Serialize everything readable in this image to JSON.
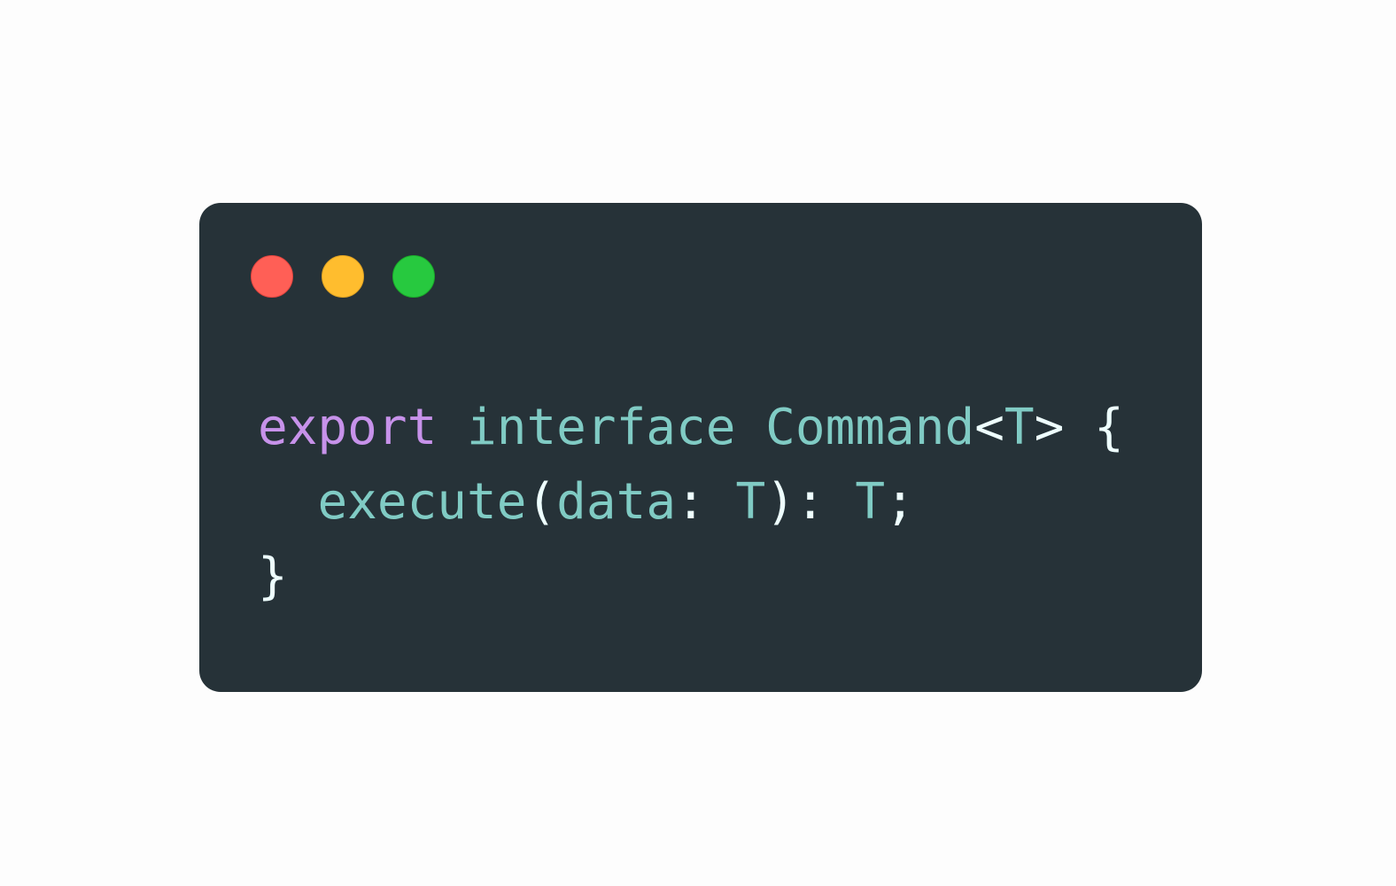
{
  "window": {
    "controls": [
      {
        "name": "close",
        "color": "#ff5f56"
      },
      {
        "name": "minimize",
        "color": "#ffbd2e"
      },
      {
        "name": "maximize",
        "color": "#27c93f"
      }
    ],
    "background": "#263238"
  },
  "code": {
    "language": "typescript",
    "colors": {
      "keyword": "#c792ea",
      "identifier": "#80cbc4",
      "punctuation": "#eeffff"
    },
    "lines": [
      [
        {
          "type": "kw",
          "text": "export"
        },
        {
          "type": "sp",
          "text": " "
        },
        {
          "type": "id",
          "text": "interface"
        },
        {
          "type": "sp",
          "text": " "
        },
        {
          "type": "id",
          "text": "Command"
        },
        {
          "type": "pn",
          "text": "<"
        },
        {
          "type": "id",
          "text": "T"
        },
        {
          "type": "pn",
          "text": ">"
        },
        {
          "type": "sp",
          "text": " "
        },
        {
          "type": "pn",
          "text": "{"
        }
      ],
      [
        {
          "type": "sp",
          "text": "  "
        },
        {
          "type": "id",
          "text": "execute"
        },
        {
          "type": "pn",
          "text": "("
        },
        {
          "type": "id",
          "text": "data"
        },
        {
          "type": "pn",
          "text": ":"
        },
        {
          "type": "sp",
          "text": " "
        },
        {
          "type": "id",
          "text": "T"
        },
        {
          "type": "pn",
          "text": "):"
        },
        {
          "type": "sp",
          "text": " "
        },
        {
          "type": "id",
          "text": "T"
        },
        {
          "type": "pn",
          "text": ";"
        }
      ],
      [
        {
          "type": "pn",
          "text": "}"
        }
      ]
    ]
  }
}
